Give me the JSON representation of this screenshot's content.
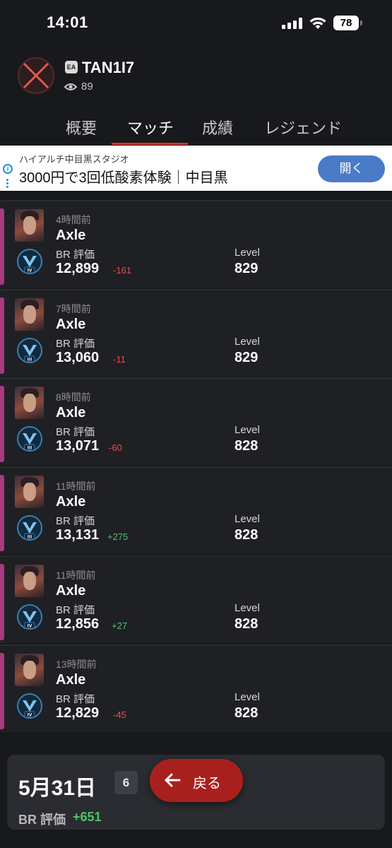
{
  "status_bar": {
    "time": "14:01",
    "battery": "78"
  },
  "profile": {
    "platform_badge": "EA",
    "username": "TAN1I7",
    "view_count": "89"
  },
  "tabs": [
    {
      "label": "概要",
      "active": false
    },
    {
      "label": "マッチ",
      "active": true
    },
    {
      "label": "成績",
      "active": false
    },
    {
      "label": "レジェンド",
      "active": false
    }
  ],
  "ad": {
    "advertiser": "ハイアルチ中目黒スタジオ",
    "headline": "3000円で3回低酸素体験｜中目黒",
    "cta": "開く"
  },
  "matches": [
    {
      "time_ago": "4時間前",
      "legend": "Axle",
      "br_label": "BR 評価",
      "br_value": "12,899",
      "br_delta": "-161",
      "rank_tier": "IV",
      "level_label": "Level",
      "level": "829"
    },
    {
      "time_ago": "7時間前",
      "legend": "Axle",
      "br_label": "BR 評価",
      "br_value": "13,060",
      "br_delta": "-11",
      "rank_tier": "III",
      "level_label": "Level",
      "level": "829"
    },
    {
      "time_ago": "8時間前",
      "legend": "Axle",
      "br_label": "BR 評価",
      "br_value": "13,071",
      "br_delta": "-60",
      "rank_tier": "III",
      "level_label": "Level",
      "level": "828"
    },
    {
      "time_ago": "11時間前",
      "legend": "Axle",
      "br_label": "BR 評価",
      "br_value": "13,131",
      "br_delta": "+275",
      "rank_tier": "III",
      "level_label": "Level",
      "level": "828"
    },
    {
      "time_ago": "11時間前",
      "legend": "Axle",
      "br_label": "BR 評価",
      "br_value": "12,856",
      "br_delta": "+27",
      "rank_tier": "IV",
      "level_label": "Level",
      "level": "828"
    },
    {
      "time_ago": "13時間前",
      "legend": "Axle",
      "br_label": "BR 評価",
      "br_value": "12,829",
      "br_delta": "-45",
      "rank_tier": "IV",
      "level_label": "Level",
      "level": "828"
    }
  ],
  "summary": {
    "date": "5月31日",
    "match_count": "6",
    "br_label": "BR 評価",
    "br_delta": "+651"
  },
  "back_button": {
    "label": "戻る"
  },
  "colors": {
    "accent_red": "#d0312d",
    "negative": "#e54b4b",
    "positive": "#4ec46b",
    "match_accent": "#a63b7d",
    "ad_button": "#4a7bc8"
  },
  "icons": {
    "avatar": "red-x-icon",
    "views": "eye-icon",
    "back": "arrow-left-icon"
  }
}
